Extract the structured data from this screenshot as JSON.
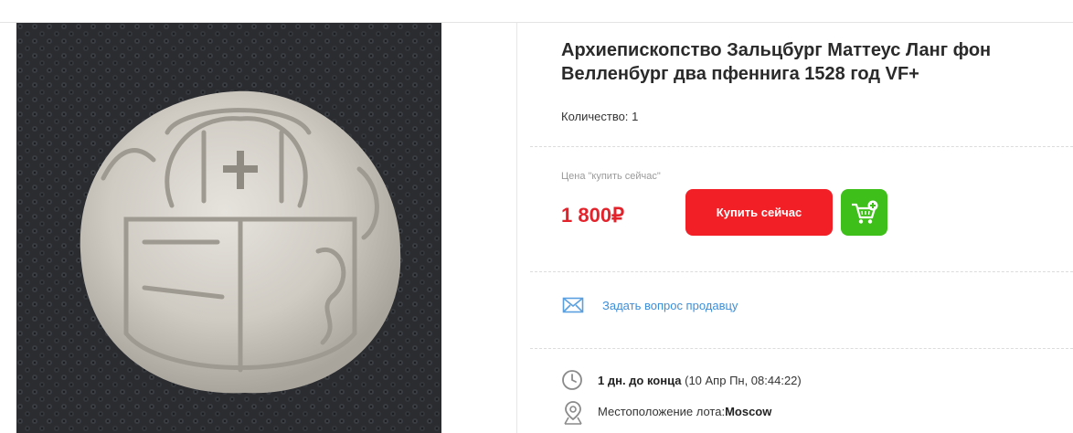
{
  "lot": {
    "title": "Архиепископство Зальцбург Маттеус Ланг фон Велленбург два пфеннига 1528 год VF+",
    "quantity_label": "Количество:",
    "quantity_value": "1"
  },
  "price": {
    "caption": "Цена \"купить сейчас\"",
    "value": "1 800₽"
  },
  "actions": {
    "buy_now_label": "Купить сейчас",
    "cart_icon": "add-to-cart-icon",
    "ask_seller_label": "Задать вопрос продавцу"
  },
  "timing": {
    "remaining": "1 дн. до конца",
    "end_date": "(10 Апр Пн, 08:44:22)"
  },
  "location": {
    "label": "Местоположение лота:",
    "value": "Moscow"
  },
  "colors": {
    "buy_button": "#f21f27",
    "cart_button": "#3fbf1a",
    "price": "#e3232c",
    "link": "#3d8ed8"
  }
}
